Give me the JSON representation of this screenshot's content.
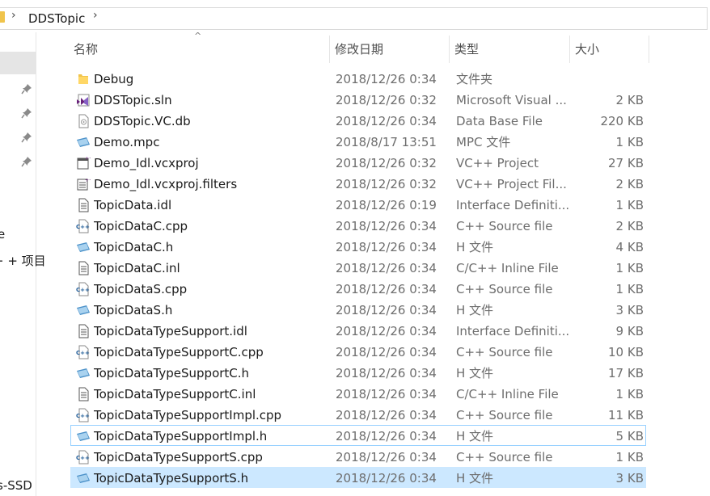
{
  "address": {
    "folder": "DDSTopic"
  },
  "nav": {
    "partial_labels": [
      "e",
      "+ + 项目",
      "s-SSD"
    ]
  },
  "columns": {
    "name": "名称",
    "date": "修改日期",
    "type": "类型",
    "size": "大小",
    "sort_indicator": "^"
  },
  "files": [
    {
      "name": "Debug",
      "date": "2018/12/26 0:34",
      "type": "文件夹",
      "size": "",
      "icon": "folder-icon"
    },
    {
      "name": "DDSTopic.sln",
      "date": "2018/12/26 0:32",
      "type": "Microsoft Visual ...",
      "size": "2 KB",
      "icon": "visual-studio-solution-icon"
    },
    {
      "name": "DDSTopic.VC.db",
      "date": "2018/12/26 0:34",
      "type": "Data Base File",
      "size": "220 KB",
      "icon": "database-file-icon"
    },
    {
      "name": "Demo.mpc",
      "date": "2018/8/17 13:51",
      "type": "MPC 文件",
      "size": "1 KB",
      "icon": "generic-file-icon"
    },
    {
      "name": "Demo_Idl.vcxproj",
      "date": "2018/12/26 0:32",
      "type": "VC++ Project",
      "size": "27 KB",
      "icon": "vcxproj-icon"
    },
    {
      "name": "Demo_Idl.vcxproj.filters",
      "date": "2018/12/26 0:32",
      "type": "VC++ Project Fil...",
      "size": "2 KB",
      "icon": "vcxproj-filters-icon"
    },
    {
      "name": "TopicData.idl",
      "date": "2018/12/26 0:19",
      "type": "Interface Definiti...",
      "size": "1 KB",
      "icon": "text-file-icon"
    },
    {
      "name": "TopicDataC.cpp",
      "date": "2018/12/26 0:34",
      "type": "C++ Source file",
      "size": "2 KB",
      "icon": "cpp-file-icon"
    },
    {
      "name": "TopicDataC.h",
      "date": "2018/12/26 0:34",
      "type": "H 文件",
      "size": "4 KB",
      "icon": "generic-file-icon"
    },
    {
      "name": "TopicDataC.inl",
      "date": "2018/12/26 0:34",
      "type": "C/C++ Inline File",
      "size": "1 KB",
      "icon": "text-file-icon"
    },
    {
      "name": "TopicDataS.cpp",
      "date": "2018/12/26 0:34",
      "type": "C++ Source file",
      "size": "1 KB",
      "icon": "cpp-file-icon"
    },
    {
      "name": "TopicDataS.h",
      "date": "2018/12/26 0:34",
      "type": "H 文件",
      "size": "3 KB",
      "icon": "generic-file-icon"
    },
    {
      "name": "TopicDataTypeSupport.idl",
      "date": "2018/12/26 0:34",
      "type": "Interface Definiti...",
      "size": "9 KB",
      "icon": "text-file-icon"
    },
    {
      "name": "TopicDataTypeSupportC.cpp",
      "date": "2018/12/26 0:34",
      "type": "C++ Source file",
      "size": "10 KB",
      "icon": "cpp-file-icon"
    },
    {
      "name": "TopicDataTypeSupportC.h",
      "date": "2018/12/26 0:34",
      "type": "H 文件",
      "size": "17 KB",
      "icon": "generic-file-icon"
    },
    {
      "name": "TopicDataTypeSupportC.inl",
      "date": "2018/12/26 0:34",
      "type": "C/C++ Inline File",
      "size": "1 KB",
      "icon": "text-file-icon"
    },
    {
      "name": "TopicDataTypeSupportImpl.cpp",
      "date": "2018/12/26 0:34",
      "type": "C++ Source file",
      "size": "11 KB",
      "icon": "cpp-file-icon"
    },
    {
      "name": "TopicDataTypeSupportImpl.h",
      "date": "2018/12/26 0:34",
      "type": "H 文件",
      "size": "5 KB",
      "icon": "generic-file-icon",
      "state": "hover"
    },
    {
      "name": "TopicDataTypeSupportS.cpp",
      "date": "2018/12/26 0:34",
      "type": "C++ Source file",
      "size": "1 KB",
      "icon": "cpp-file-icon"
    },
    {
      "name": "TopicDataTypeSupportS.h",
      "date": "2018/12/26 0:34",
      "type": "H 文件",
      "size": "3 KB",
      "icon": "generic-file-icon",
      "state": "selected"
    }
  ],
  "colors": {
    "selected_bg": "#cce8ff",
    "hover_border": "#99d1ff",
    "folder": "#f0c44c",
    "text_secondary": "#6d6d6d"
  }
}
